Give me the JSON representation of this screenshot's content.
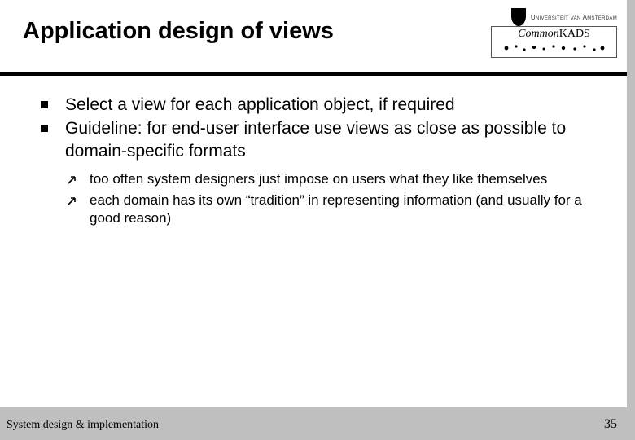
{
  "header": {
    "title": "Application design of views",
    "uva_label": "Universiteit van Amsterdam",
    "ck_label_plain": "Common",
    "ck_label_italic": "KADS"
  },
  "bullets": {
    "level1": [
      "Select a view for each application object, if required",
      "Guideline: for end-user interface use views as close as possible to domain-specific formats"
    ],
    "level2": [
      "too often system designers just impose on users what they like themselves",
      "each domain has its own “tradition” in representing information (and usually for a good reason)"
    ]
  },
  "footer": {
    "left": "System design & implementation",
    "page": "35"
  },
  "icons": {
    "square_bullet": "square-bullet-icon",
    "arrow_bullet": "arrow-up-right-icon",
    "uva": "uva-crest-icon",
    "ck": "commonkads-logo"
  }
}
